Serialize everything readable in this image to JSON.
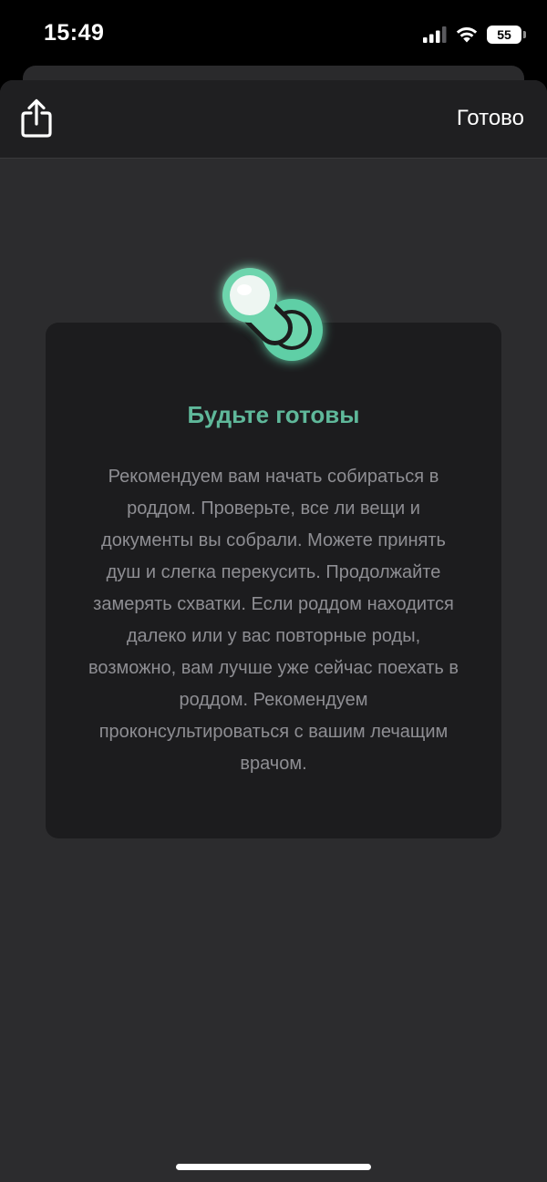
{
  "status_bar": {
    "time": "15:49",
    "battery": "55",
    "icons": [
      "cellular-signal-icon",
      "wifi-icon",
      "battery-icon"
    ]
  },
  "nav": {
    "share_icon": "share-icon",
    "done_label": "Готово"
  },
  "card": {
    "icon": "pacifier-icon",
    "title": "Будьте готовы",
    "text": "Рекомендуем вам начать собираться в роддом. Проверьте, все ли вещи и документы вы собрали. Можете принять душ и слегка перекусить. Продолжайте замерять схватки. Если роддом находится далеко или у вас повторные роды, возможно, вам лучше уже сейчас поехать в роддом. Рекомендуем проконсультироваться с вашим лечащим врачом."
  },
  "colors": {
    "accent": "#5fb89a",
    "icon_fill": "#6dd5ad",
    "card_bg": "#1c1c1e",
    "sheet_bg": "#2c2c2e",
    "nav_bg": "#1f1f21",
    "body_text": "#8e8e93"
  }
}
